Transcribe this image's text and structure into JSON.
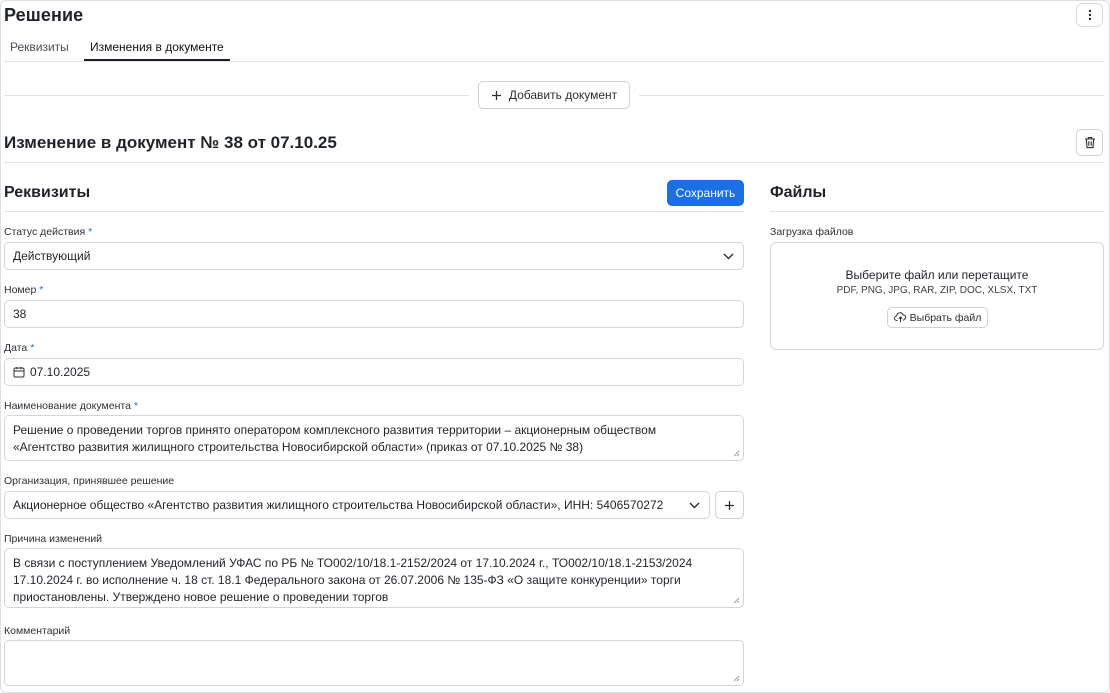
{
  "page": {
    "title": "Решение"
  },
  "tabs": [
    {
      "label": "Реквизиты",
      "active": false
    },
    {
      "label": "Изменения в документе",
      "active": true
    }
  ],
  "add_document": {
    "label": "Добавить документ"
  },
  "change": {
    "title": "Изменение в документ № 38 от 07.10.25"
  },
  "requisites": {
    "title": "Реквизиты",
    "save_label": "Сохранить",
    "status": {
      "label": "Статус действия",
      "required_mark": "*",
      "value": "Действующий"
    },
    "number": {
      "label": "Номер",
      "required_mark": "*",
      "value": "38"
    },
    "date": {
      "label": "Дата",
      "required_mark": "*",
      "value": "07.10.2025"
    },
    "doc_name": {
      "label": "Наименование документа",
      "required_mark": "*",
      "lines": [
        "Решение о проведении торгов принято оператором комплексного развития территории – акционерным обществом",
        "«Агентство развития жилищного строительства Новосибирской области» (приказ от 07.10.2025 № 38)"
      ]
    },
    "organization": {
      "label": "Организация, принявшее решение",
      "value": "Акционерное общество «Агентство развития жилищного строительства Новосибирской области», ИНН: 5406570272"
    },
    "reason": {
      "label": "Причина изменений",
      "lines": [
        "В связи с поступлением Уведомлений УФАС по РБ № ТО002/10/18.1-2152/2024 от 17.10.2024 г., ТО002/10/18.1-2153/2024",
        "17.10.2024 г. во исполнение ч. 18 ст. 18.1 Федерального закона от 26.07.2006 № 135-ФЗ «О защите конкуренции» торги",
        "приостановлены. Утверждено новое решение о проведении торгов"
      ]
    },
    "comment": {
      "label": "Комментарий",
      "value": ""
    }
  },
  "files": {
    "title": "Файлы",
    "upload_label": "Загрузка файлов",
    "drop_title": "Выберите файл или перетащите",
    "formats": "PDF, PNG, JPG, RAR, ZIP, DOC, XLSX, TXT",
    "choose_label": "Выбрать файл"
  },
  "colors": {
    "primary": "#1b6fe3",
    "border": "#d2d6db",
    "text": "#1f2329"
  },
  "icons": {
    "more": "more-vertical-icon",
    "plus": "plus-icon",
    "trash": "trash-icon",
    "chevron": "chevron-down-icon",
    "calendar": "calendar-icon",
    "upload": "cloud-upload-icon"
  }
}
